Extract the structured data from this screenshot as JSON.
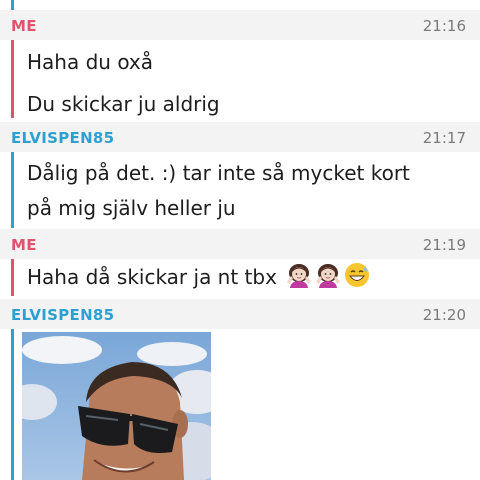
{
  "colors": {
    "me": "#e1526e",
    "other": "#2ea0d0"
  },
  "blocks": [
    {
      "sender": "ME",
      "time": "21:16",
      "messages": [
        "Haha du oxå",
        "Du skickar ju aldrig"
      ]
    },
    {
      "sender": "ELVISPEN85",
      "time": "21:17",
      "messages": [
        "Dålig på det. :) tar inte så mycket kort",
        "på mig själv heller ju"
      ]
    },
    {
      "sender": "ME",
      "time": "21:19",
      "messages": [
        "Haha då skickar ja nt tbx"
      ],
      "emojis": [
        "person-shrugging-emoji",
        "person-shrugging-emoji",
        "grinning-sweat-emoji"
      ]
    },
    {
      "sender": "ELVISPEN85",
      "time": "21:20",
      "attachment": "photo"
    }
  ]
}
